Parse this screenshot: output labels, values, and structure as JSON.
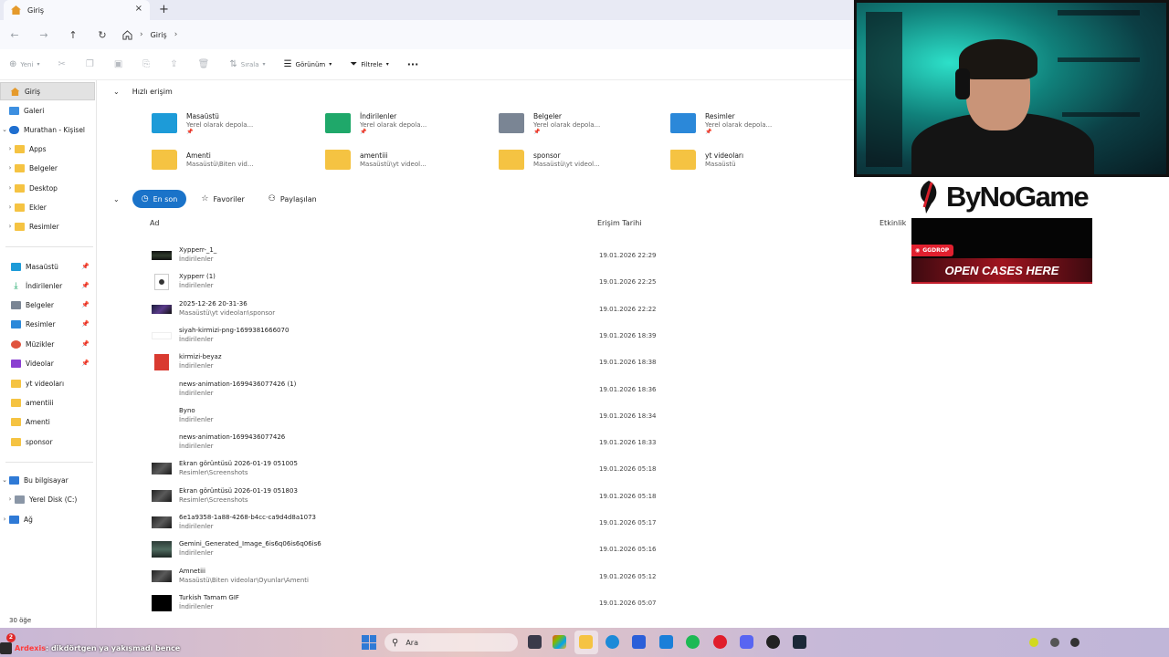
{
  "window": {
    "tab_title": "Giriş",
    "tab_close": "×",
    "tab_add": "+"
  },
  "nav": {
    "back": "←",
    "forward": "→",
    "up": "↑",
    "refresh": "↻",
    "breadcrumb": [
      "Giriş"
    ],
    "sep": "›"
  },
  "commands": {
    "new": "Yeni",
    "sort": "Sırala",
    "view": "Görünüm",
    "filter": "Filtrele",
    "more": "···"
  },
  "sidebar": {
    "home": "Giriş",
    "gallery": "Galeri",
    "onedrive": "Murathan - Kişisel",
    "onedrive_children": [
      "Apps",
      "Belgeler",
      "Desktop",
      "Ekler",
      "Resimler"
    ],
    "pinned": [
      "Masaüstü",
      "İndirilenler",
      "Belgeler",
      "Resimler",
      "Müzikler",
      "Videolar"
    ],
    "folders": [
      "yt videoları",
      "amentiii",
      "Amenti",
      "sponsor"
    ],
    "this_pc": "Bu bilgisayar",
    "local_disk": "Yerel Disk (C:)",
    "network": "Ağ"
  },
  "status": {
    "items": "30 öğe"
  },
  "quick_access": {
    "title": "Hızlı erişim",
    "items": [
      {
        "name": "Masaüstü",
        "sub": "Yerel olarak depola...",
        "pinned": true,
        "icon": "desktop-icon",
        "color": "#1d9bd8"
      },
      {
        "name": "İndirilenler",
        "sub": "Yerel olarak depola...",
        "pinned": true,
        "icon": "downloads-icon",
        "color": "#1fa86a"
      },
      {
        "name": "Belgeler",
        "sub": "Yerel olarak depola...",
        "pinned": true,
        "icon": "documents-icon",
        "color": "#7a8594"
      },
      {
        "name": "Resimler",
        "sub": "Yerel olarak depola...",
        "pinned": true,
        "icon": "pictures-icon",
        "color": "#2b88d9"
      },
      {
        "name": "Amenti",
        "sub": "Masaüstü\\Biten vid...",
        "pinned": false,
        "icon": "folder-icon",
        "color": "#f5c342"
      },
      {
        "name": "amentiii",
        "sub": "Masaüstü\\yt videol...",
        "pinned": false,
        "icon": "folder-icon",
        "color": "#f5c342"
      },
      {
        "name": "sponsor",
        "sub": "Masaüstü\\yt videol...",
        "pinned": false,
        "icon": "folder-icon",
        "color": "#f5c342"
      },
      {
        "name": "yt videoları",
        "sub": "Masaüstü",
        "pinned": false,
        "icon": "folder-icon",
        "color": "#f5c342"
      }
    ]
  },
  "filters": {
    "recent": "En son",
    "favorites": "Favoriler",
    "shared": "Paylaşılan"
  },
  "columns": {
    "name": "Ad",
    "date": "Erişim Tarihi",
    "activity": "Etkinlik"
  },
  "files": [
    {
      "name": "Xypperr-_1_",
      "loc": "İndirilenler",
      "date": "19.01.2026 22:29",
      "thumb": "video"
    },
    {
      "name": "Xypperr (1)",
      "loc": "İndirilenler",
      "date": "19.01.2026 22:25",
      "thumb": "media"
    },
    {
      "name": "2025-12-26 20-31-36",
      "loc": "Masaüstü\\yt videoları\\sponsor",
      "date": "19.01.2026 22:22",
      "thumb": "video2"
    },
    {
      "name": "siyah-kirmizi-png-1699381666070",
      "loc": "İndirilenler",
      "date": "19.01.2026 18:39",
      "thumb": "logo"
    },
    {
      "name": "kirmizi-beyaz",
      "loc": "İndirilenler",
      "date": "19.01.2026 18:38",
      "thumb": "pdf"
    },
    {
      "name": "news-animation-1699436077426 (1)",
      "loc": "İndirilenler",
      "date": "19.01.2026 18:36",
      "thumb": "none"
    },
    {
      "name": "Byno",
      "loc": "İndirilenler",
      "date": "19.01.2026 18:34",
      "thumb": "none"
    },
    {
      "name": "news-animation-1699436077426",
      "loc": "İndirilenler",
      "date": "19.01.2026 18:33",
      "thumb": "none"
    },
    {
      "name": "Ekran görüntüsü 2026-01-19 051005",
      "loc": "Resimler\\Screenshots",
      "date": "19.01.2026 05:18",
      "thumb": "shot"
    },
    {
      "name": "Ekran görüntüsü 2026-01-19 051803",
      "loc": "Resimler\\Screenshots",
      "date": "19.01.2026 05:18",
      "thumb": "shot"
    },
    {
      "name": "6e1a9358-1a88-4268-b4cc-ca9d4d8a1073",
      "loc": "İndirilenler",
      "date": "19.01.2026 05:17",
      "thumb": "shot"
    },
    {
      "name": "Gemini_Generated_Image_6is6q06is6q06is6",
      "loc": "İndirilenler",
      "date": "19.01.2026 05:16",
      "thumb": "portrait"
    },
    {
      "name": "Amnetiii",
      "loc": "Masaüstü\\Biten videolar\\Oyunlar\\Amenti",
      "date": "19.01.2026 05:12",
      "thumb": "shot"
    },
    {
      "name": "Turkish Tamam GIF",
      "loc": "İndirilenler",
      "date": "19.01.2026 05:07",
      "thumb": "black"
    }
  ],
  "overlay": {
    "brand": "ByNoGame",
    "ad_badge": "GGDROP",
    "ad_cta": "OPEN CASES HERE"
  },
  "taskbar": {
    "chat_count": "2",
    "chat_user": "Ardexis",
    "chat_msg": ": dikdörtgen ya yakışmadı bence",
    "search_placeholder": "Ara"
  }
}
